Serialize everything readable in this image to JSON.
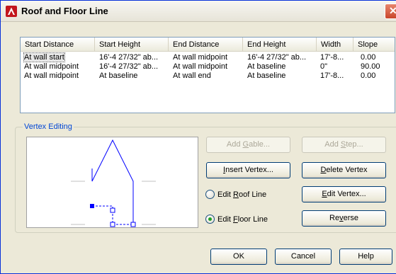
{
  "window": {
    "title": "Roof and Floor Line",
    "close_glyph": "✕"
  },
  "table": {
    "columns": [
      "Start Distance",
      "Start Height",
      "End Distance",
      "End Height",
      "Width",
      "Slope"
    ],
    "rows": [
      [
        "At wall start",
        "16'-4 27/32\" ab...",
        "At wall midpoint",
        "16'-4 27/32\" ab...",
        "17'-8...",
        "0.00"
      ],
      [
        "At wall midpoint",
        "16'-4 27/32\" ab...",
        "At wall midpoint",
        "At baseline",
        "0\"",
        "90.00"
      ],
      [
        "At wall midpoint",
        "At baseline",
        "At wall end",
        "At baseline",
        "17'-8...",
        "0.00"
      ]
    ],
    "selected_row": 0
  },
  "vertex_editing": {
    "label": "Vertex Editing",
    "add_gable": {
      "pre": "Add ",
      "accel": "G",
      "post": "able..."
    },
    "add_step": {
      "pre": "Add ",
      "accel": "S",
      "post": "tep..."
    },
    "insert_vertex": {
      "pre": "",
      "accel": "I",
      "post": "nsert Vertex..."
    },
    "delete_vertex": {
      "pre": "",
      "accel": "D",
      "post": "elete Vertex"
    },
    "edit_vertex": {
      "pre": "",
      "accel": "E",
      "post": "dit Vertex..."
    },
    "reverse": {
      "pre": "Re",
      "accel": "v",
      "post": "erse"
    },
    "edit_roof_line": {
      "pre": "Edit ",
      "accel": "R",
      "post": "oof Line",
      "checked": false
    },
    "edit_floor_line": {
      "pre": "Edit ",
      "accel": "F",
      "post": "loor Line",
      "checked": true
    }
  },
  "footer": {
    "ok": "OK",
    "cancel": "Cancel",
    "help": "Help"
  },
  "colors": {
    "accent": "#0046d5",
    "preview_line": "#0000ff",
    "preview_guide": "#c0c0c0"
  }
}
